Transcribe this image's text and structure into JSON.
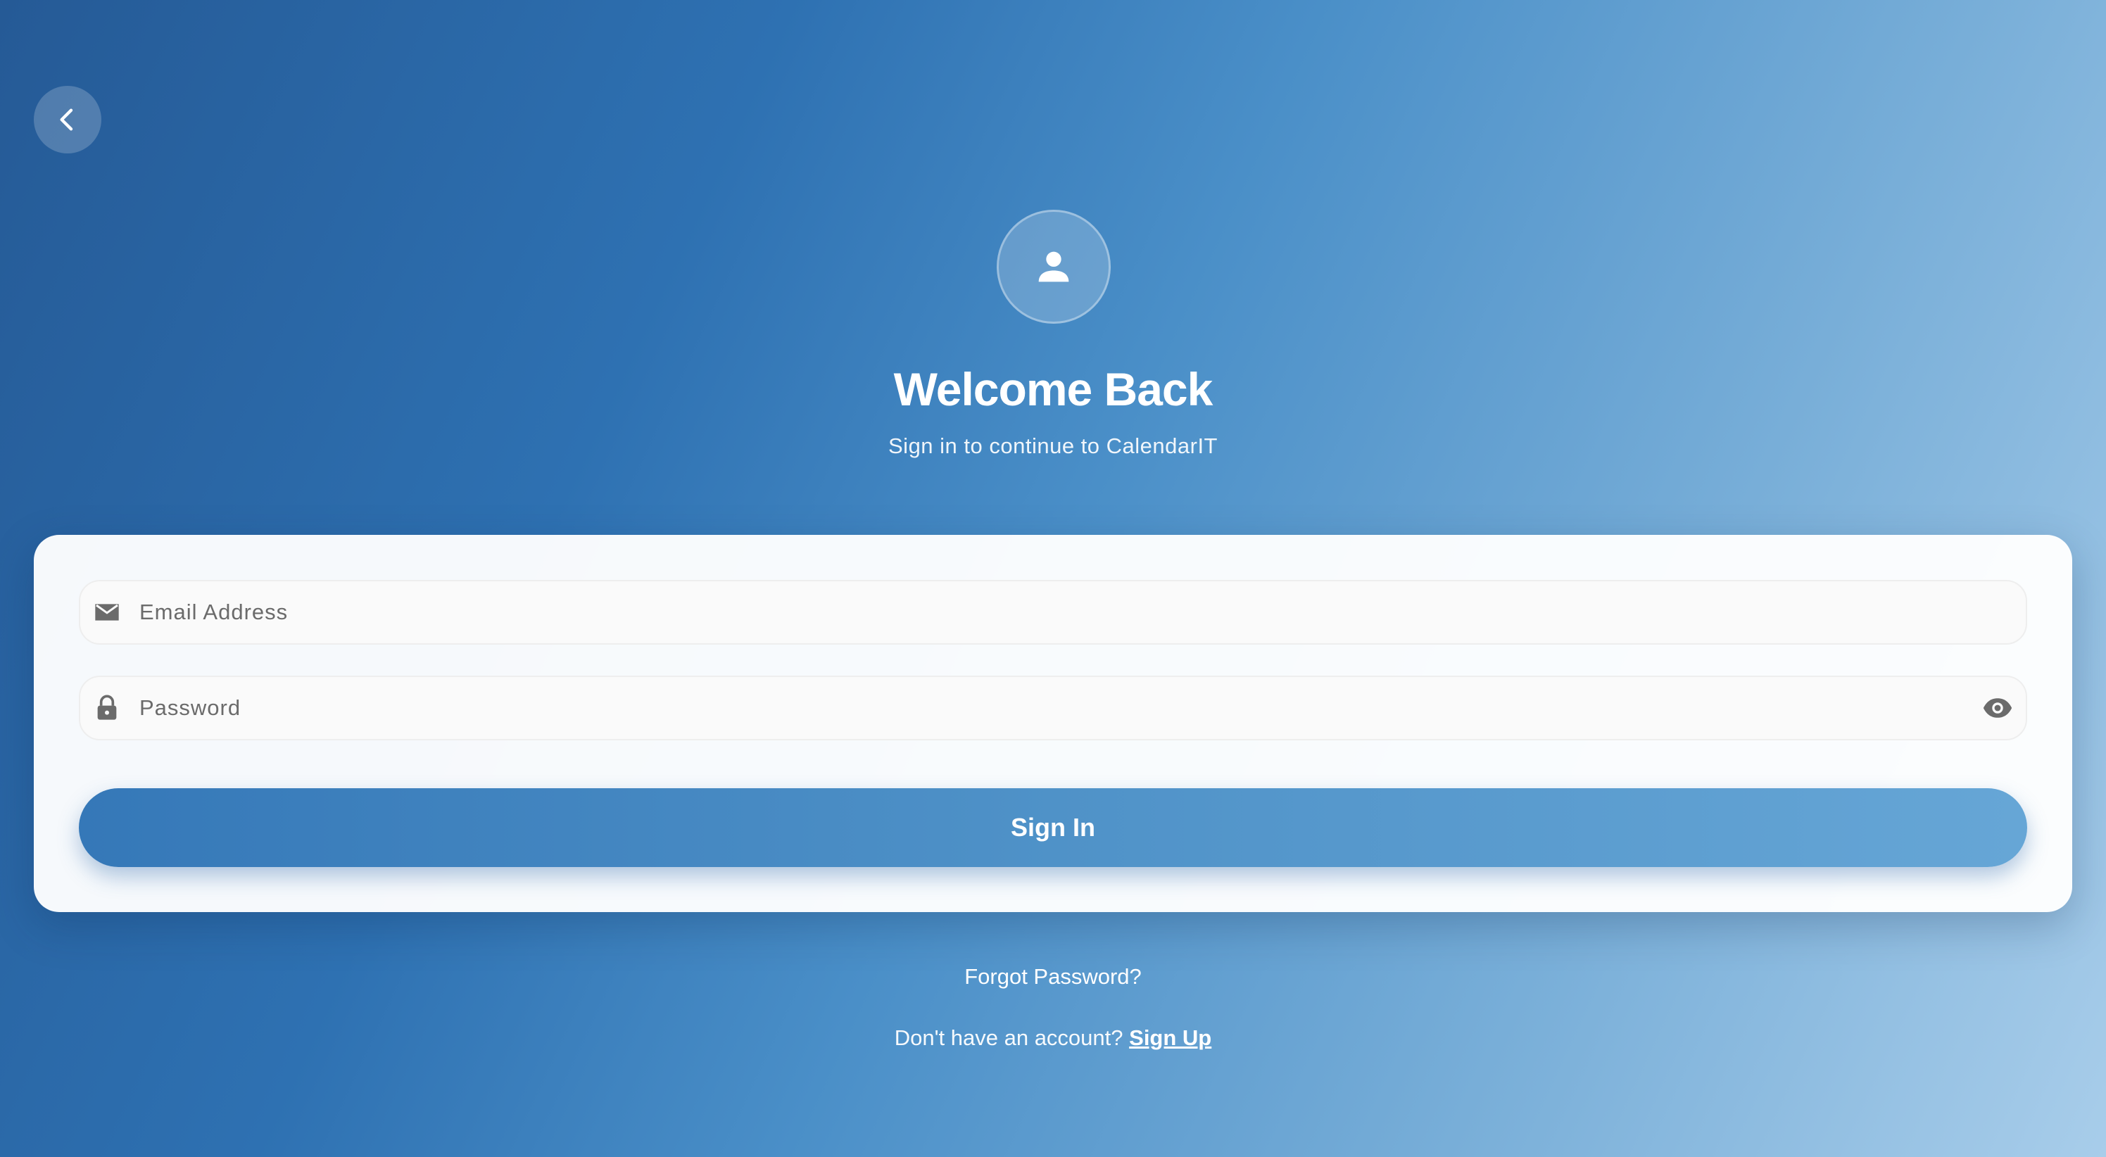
{
  "header": {
    "back_icon": "chevron-left-icon",
    "avatar_icon": "person-icon",
    "title": "Welcome Back",
    "subtitle": "Sign in to continue to CalendarIT"
  },
  "form": {
    "email": {
      "icon": "mail-icon",
      "placeholder": "Email Address",
      "value": ""
    },
    "password": {
      "icon": "lock-icon",
      "placeholder": "Password",
      "value": "",
      "visibility_icon": "eye-icon"
    },
    "submit_label": "Sign In"
  },
  "footer": {
    "forgot_password": "Forgot Password?",
    "no_account_text": "Don't have an account?",
    "signup_label": "Sign Up"
  },
  "colors": {
    "background_start": "#255a96",
    "background_end": "#a8cdea",
    "button_start": "#3578b8",
    "button_end": "#66a6d6",
    "icon_gray": "#6b6b6b"
  }
}
